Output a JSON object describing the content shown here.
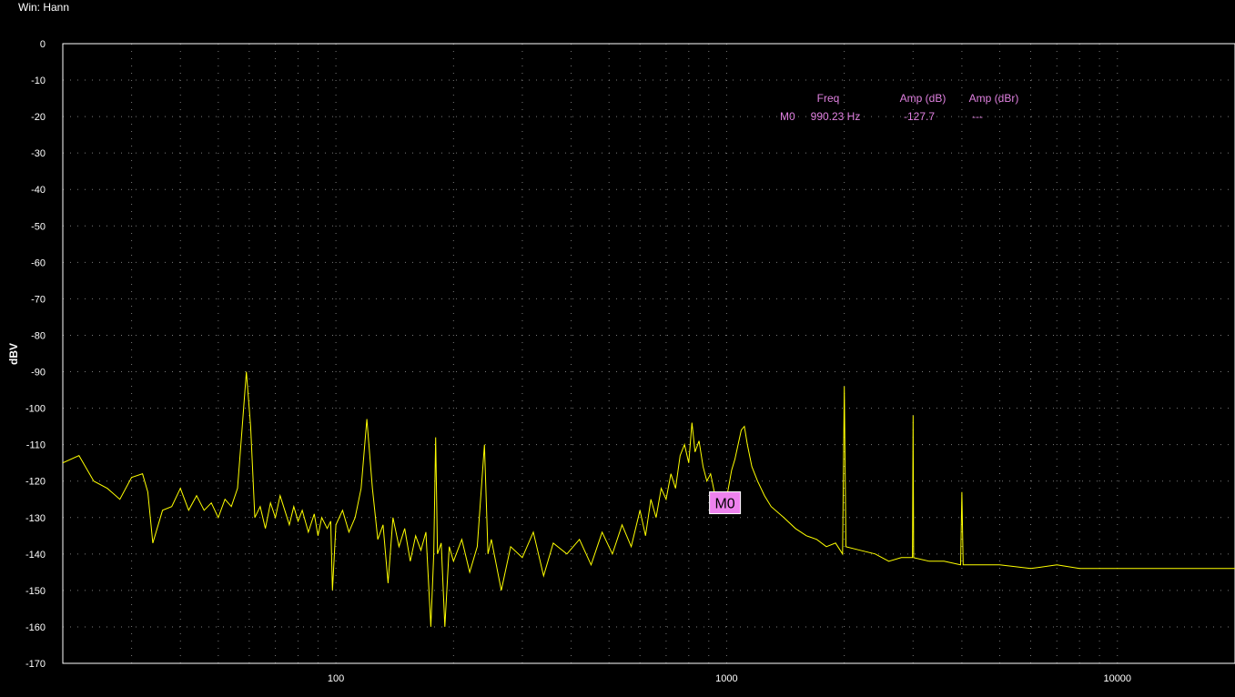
{
  "window": {
    "label": "Win: Hann"
  },
  "marker_table": {
    "headers": {
      "freq": "Freq",
      "amp_db": "Amp (dB)",
      "amp_dbr": "Amp (dBr)"
    },
    "rows": [
      {
        "marker": "M0",
        "freq": "990.23 Hz",
        "amp_db": "-127.7",
        "amp_dbr": "---"
      }
    ]
  },
  "colors": {
    "background": "#000000",
    "trace": "#ffff00",
    "grid": "#7a7a7a",
    "axis": "#ffffff",
    "marker_fill": "#ee82ee",
    "marker_text": "#e080e0"
  },
  "chart_data": {
    "type": "line",
    "title": "",
    "xlabel": "",
    "ylabel": "dBV",
    "x_scale": "log",
    "xlim": [
      20,
      20000
    ],
    "ylim": [
      -170,
      0
    ],
    "grid": true,
    "x_tick_labels": [
      {
        "value": 100,
        "label": "100"
      },
      {
        "value": 1000,
        "label": "1000"
      },
      {
        "value": 10000,
        "label": "10000"
      }
    ],
    "y_tick_labels": [
      {
        "value": 0,
        "label": "0"
      },
      {
        "value": -10,
        "label": "-10"
      },
      {
        "value": -20,
        "label": "-20"
      },
      {
        "value": -30,
        "label": "-30"
      },
      {
        "value": -40,
        "label": "-40"
      },
      {
        "value": -50,
        "label": "-50"
      },
      {
        "value": -60,
        "label": "-60"
      },
      {
        "value": -70,
        "label": "-70"
      },
      {
        "value": -80,
        "label": "-80"
      },
      {
        "value": -90,
        "label": "-90"
      },
      {
        "value": -100,
        "label": "-100"
      },
      {
        "value": -110,
        "label": "-110"
      },
      {
        "value": -120,
        "label": "-120"
      },
      {
        "value": -130,
        "label": "-130"
      },
      {
        "value": -140,
        "label": "-140"
      },
      {
        "value": -150,
        "label": "-150"
      },
      {
        "value": -160,
        "label": "-160"
      },
      {
        "value": -170,
        "label": "-170"
      }
    ],
    "markers": [
      {
        "label": "M0",
        "x": 990.23,
        "y": -127.7
      }
    ],
    "series": [
      {
        "points": [
          [
            20,
            -115
          ],
          [
            22,
            -113
          ],
          [
            24,
            -120
          ],
          [
            26,
            -122
          ],
          [
            28,
            -125
          ],
          [
            30,
            -119
          ],
          [
            32,
            -118
          ],
          [
            33,
            -123
          ],
          [
            34,
            -137
          ],
          [
            36,
            -128
          ],
          [
            38,
            -127
          ],
          [
            40,
            -122
          ],
          [
            42,
            -128
          ],
          [
            44,
            -124
          ],
          [
            46,
            -128
          ],
          [
            48,
            -126
          ],
          [
            50,
            -130
          ],
          [
            52,
            -125
          ],
          [
            54,
            -127
          ],
          [
            56,
            -122
          ],
          [
            57.5,
            -106
          ],
          [
            59,
            -90
          ],
          [
            60.5,
            -105
          ],
          [
            62,
            -130
          ],
          [
            64,
            -127
          ],
          [
            66,
            -133
          ],
          [
            68,
            -126
          ],
          [
            70,
            -130
          ],
          [
            72,
            -124
          ],
          [
            74,
            -128
          ],
          [
            76,
            -132
          ],
          [
            78,
            -127
          ],
          [
            80,
            -131
          ],
          [
            82,
            -128
          ],
          [
            85,
            -134
          ],
          [
            88,
            -129
          ],
          [
            90,
            -135
          ],
          [
            92,
            -130
          ],
          [
            95,
            -133
          ],
          [
            97,
            -131
          ],
          [
            98,
            -150
          ],
          [
            100,
            -132
          ],
          [
            104,
            -128
          ],
          [
            108,
            -134
          ],
          [
            112,
            -130
          ],
          [
            116,
            -122
          ],
          [
            120,
            -103
          ],
          [
            124,
            -122
          ],
          [
            128,
            -136
          ],
          [
            132,
            -132
          ],
          [
            136,
            -148
          ],
          [
            140,
            -130
          ],
          [
            145,
            -138
          ],
          [
            150,
            -133
          ],
          [
            155,
            -142
          ],
          [
            160,
            -135
          ],
          [
            165,
            -139
          ],
          [
            170,
            -134
          ],
          [
            175,
            -160
          ],
          [
            178,
            -140
          ],
          [
            180,
            -108
          ],
          [
            182,
            -140
          ],
          [
            186,
            -137
          ],
          [
            190,
            -160
          ],
          [
            195,
            -138
          ],
          [
            200,
            -142
          ],
          [
            210,
            -136
          ],
          [
            220,
            -145
          ],
          [
            230,
            -138
          ],
          [
            240,
            -110
          ],
          [
            245,
            -140
          ],
          [
            250,
            -136
          ],
          [
            265,
            -150
          ],
          [
            280,
            -138
          ],
          [
            300,
            -141
          ],
          [
            320,
            -134
          ],
          [
            340,
            -146
          ],
          [
            360,
            -137
          ],
          [
            390,
            -140
          ],
          [
            420,
            -136
          ],
          [
            450,
            -143
          ],
          [
            480,
            -134
          ],
          [
            510,
            -140
          ],
          [
            540,
            -132
          ],
          [
            570,
            -138
          ],
          [
            600,
            -128
          ],
          [
            620,
            -135
          ],
          [
            640,
            -125
          ],
          [
            660,
            -130
          ],
          [
            680,
            -122
          ],
          [
            700,
            -125
          ],
          [
            720,
            -118
          ],
          [
            740,
            -122
          ],
          [
            760,
            -113
          ],
          [
            780,
            -110
          ],
          [
            800,
            -115
          ],
          [
            815,
            -104
          ],
          [
            830,
            -112
          ],
          [
            850,
            -109
          ],
          [
            870,
            -116
          ],
          [
            890,
            -120
          ],
          [
            910,
            -118
          ],
          [
            930,
            -123
          ],
          [
            950,
            -124
          ],
          [
            970,
            -126
          ],
          [
            990,
            -127
          ],
          [
            1010,
            -122
          ],
          [
            1030,
            -117
          ],
          [
            1050,
            -114
          ],
          [
            1070,
            -110
          ],
          [
            1090,
            -106
          ],
          [
            1110,
            -105
          ],
          [
            1130,
            -110
          ],
          [
            1160,
            -116
          ],
          [
            1200,
            -120
          ],
          [
            1250,
            -124
          ],
          [
            1300,
            -127
          ],
          [
            1400,
            -130
          ],
          [
            1500,
            -133
          ],
          [
            1600,
            -135
          ],
          [
            1700,
            -136
          ],
          [
            1800,
            -138
          ],
          [
            1900,
            -137
          ],
          [
            1980,
            -140
          ],
          [
            2000,
            -94
          ],
          [
            2020,
            -138
          ],
          [
            2200,
            -139
          ],
          [
            2400,
            -140
          ],
          [
            2600,
            -142
          ],
          [
            2800,
            -141
          ],
          [
            2990,
            -141
          ],
          [
            3000,
            -102
          ],
          [
            3010,
            -141
          ],
          [
            3300,
            -142
          ],
          [
            3600,
            -142
          ],
          [
            3970,
            -143
          ],
          [
            4000,
            -123
          ],
          [
            4030,
            -143
          ],
          [
            4500,
            -143
          ],
          [
            5000,
            -143
          ],
          [
            6000,
            -144
          ],
          [
            7000,
            -143
          ],
          [
            8000,
            -144
          ],
          [
            10000,
            -144
          ],
          [
            12000,
            -144
          ],
          [
            14000,
            -144
          ],
          [
            17000,
            -144
          ],
          [
            20000,
            -144
          ]
        ]
      }
    ]
  }
}
